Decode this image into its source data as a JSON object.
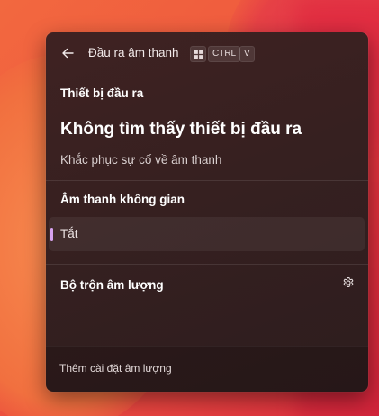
{
  "header": {
    "title": "Đầu ra âm thanh",
    "back_icon": "back-arrow-icon",
    "shortcut": {
      "win_icon": "windows-logo-icon",
      "ctrl": "CTRL",
      "v": "V"
    }
  },
  "output": {
    "section_label": "Thiết bị đầu ra",
    "no_device_message": "Không tìm thấy thiết bị đầu ra",
    "troubleshoot_link": "Khắc phục sự cố về âm thanh"
  },
  "spatial_sound": {
    "section_label": "Âm thanh không gian",
    "selected_option": "Tắt",
    "indicator_color": "#d7a3f0"
  },
  "mixer": {
    "section_label": "Bộ trộn âm lượng",
    "settings_icon": "gear-icon"
  },
  "footer": {
    "more_settings_link": "Thêm cài đặt âm lượng"
  }
}
